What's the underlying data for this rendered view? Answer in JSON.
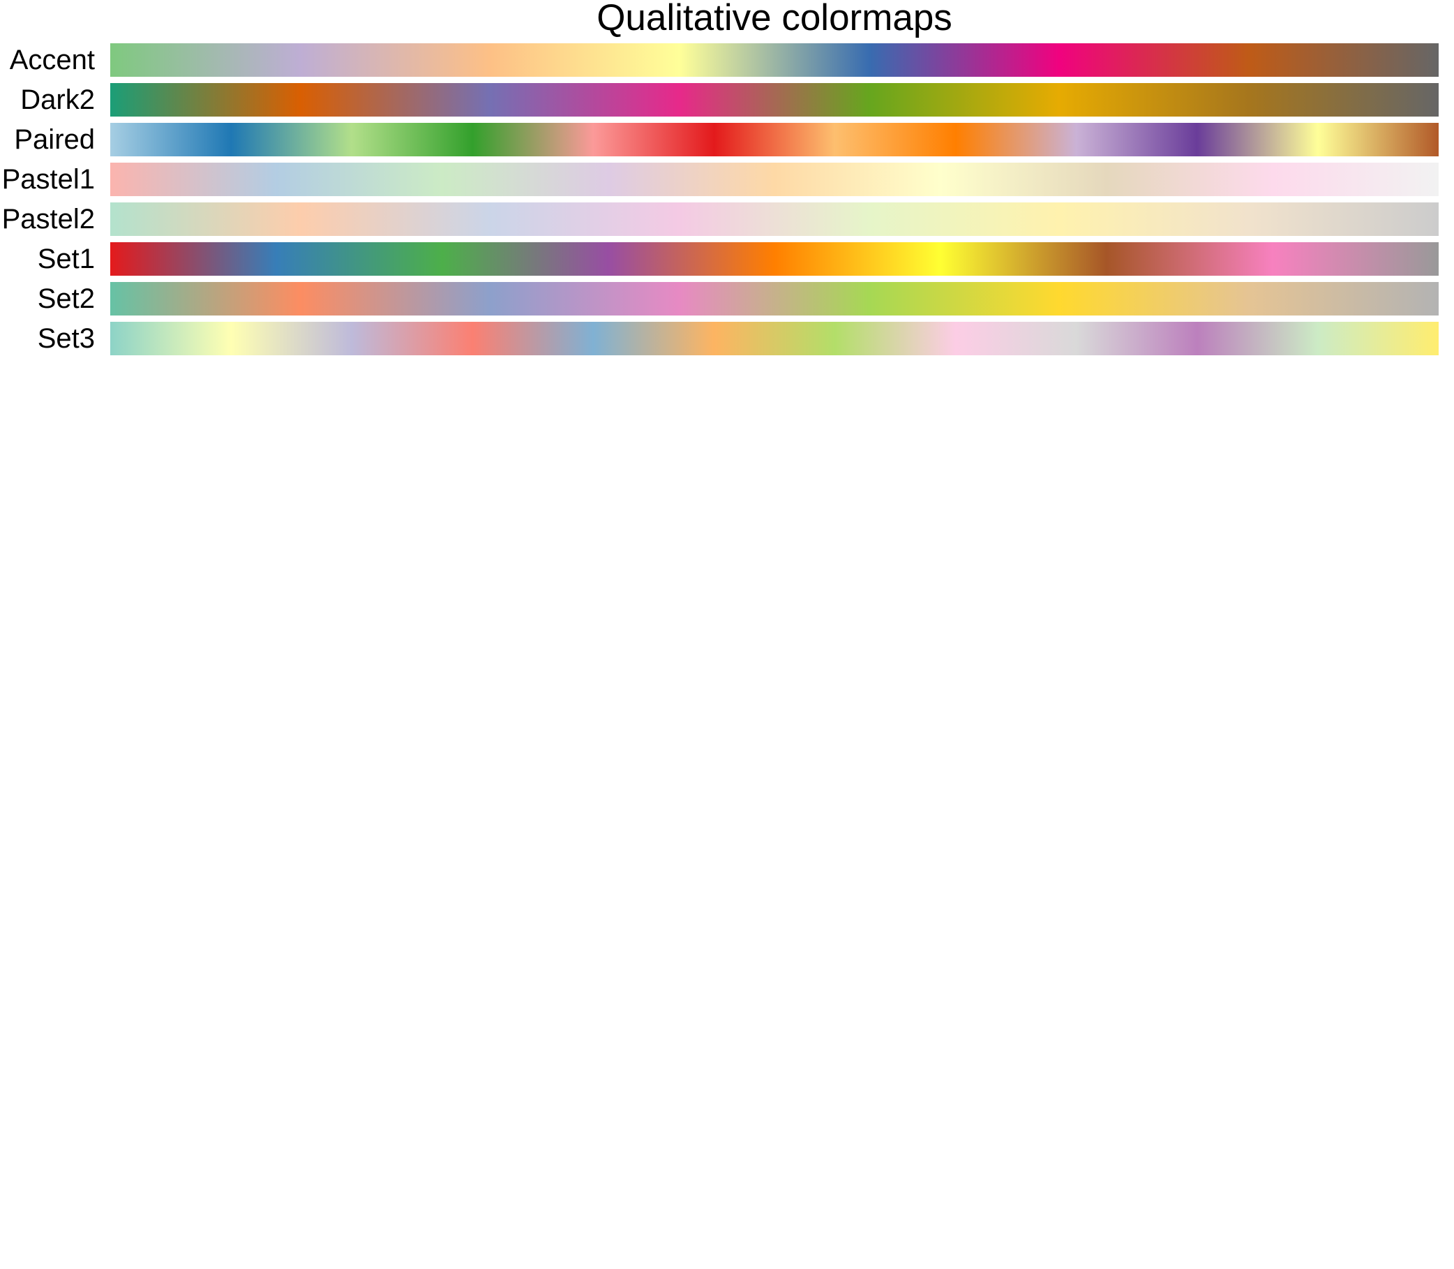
{
  "chart_data": {
    "type": "heatmap",
    "title": "Qualitative colormaps",
    "xlabel": "",
    "ylabel": "",
    "grid": false,
    "colormaps": [
      {
        "name": "Accent",
        "colors": [
          "#7fc97f",
          "#beaed4",
          "#fdc086",
          "#ffff99",
          "#386cb0",
          "#f0027f",
          "#bf5b17",
          "#666666"
        ]
      },
      {
        "name": "Dark2",
        "colors": [
          "#1b9e77",
          "#d95f02",
          "#7570b3",
          "#e7298a",
          "#66a61e",
          "#e6ab02",
          "#a6761d",
          "#666666"
        ]
      },
      {
        "name": "Paired",
        "colors": [
          "#a6cee3",
          "#1f78b4",
          "#b2df8a",
          "#33a02c",
          "#fb9a99",
          "#e31a1c",
          "#fdbf6f",
          "#ff7f00",
          "#cab2d6",
          "#6a3d9a",
          "#ffff99",
          "#b15928"
        ]
      },
      {
        "name": "Pastel1",
        "colors": [
          "#fbb4ae",
          "#b3cde3",
          "#ccebc5",
          "#decbe4",
          "#fed9a6",
          "#ffffcc",
          "#e5d8bd",
          "#fddaec",
          "#f2f2f2"
        ]
      },
      {
        "name": "Pastel2",
        "colors": [
          "#b3e2cd",
          "#fdcdac",
          "#cbd5e8",
          "#f4cae4",
          "#e6f5c9",
          "#fff2ae",
          "#f1e2cc",
          "#cccccc"
        ]
      },
      {
        "name": "Set1",
        "colors": [
          "#e41a1c",
          "#377eb8",
          "#4daf4a",
          "#984ea3",
          "#ff7f00",
          "#ffff33",
          "#a65628",
          "#f781bf",
          "#999999"
        ]
      },
      {
        "name": "Set2",
        "colors": [
          "#66c2a5",
          "#fc8d62",
          "#8da0cb",
          "#e78ac3",
          "#a6d854",
          "#ffd92f",
          "#e5c494",
          "#b3b3b3"
        ]
      },
      {
        "name": "Set3",
        "colors": [
          "#8dd3c7",
          "#ffffb3",
          "#bebada",
          "#fb8072",
          "#80b1d3",
          "#fdb462",
          "#b3de69",
          "#fccde5",
          "#d9d9d9",
          "#bc80bd",
          "#ccebc5",
          "#ffed6f"
        ]
      }
    ]
  }
}
